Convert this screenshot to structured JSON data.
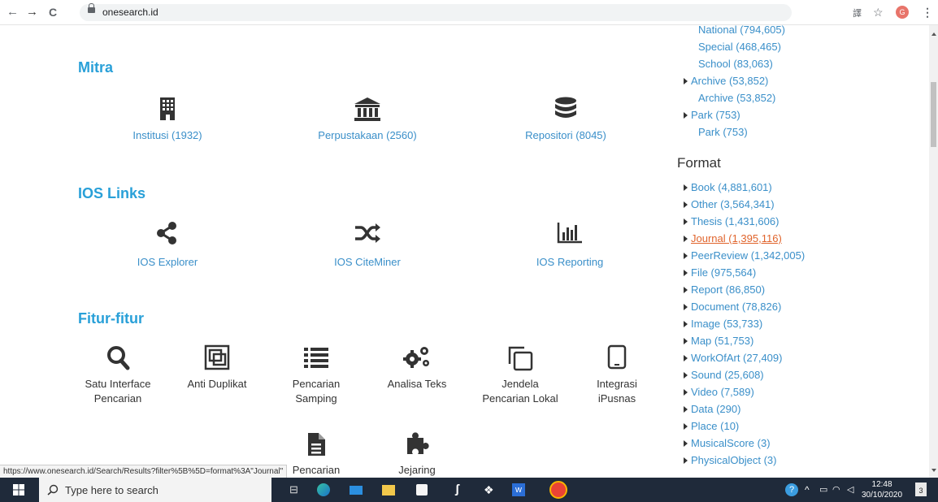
{
  "browser": {
    "url": "onesearch.id",
    "nav_back": "←",
    "nav_forward": "→",
    "nav_reload": "C"
  },
  "main": {
    "mitra": {
      "title": "Mitra",
      "items": [
        {
          "label": "Institusi (1932)",
          "icon": "building-icon"
        },
        {
          "label": "Perpustakaan (2560)",
          "icon": "library-icon"
        },
        {
          "label": "Repositori (8045)",
          "icon": "database-icon"
        }
      ]
    },
    "ios_links": {
      "title": "IOS Links",
      "items": [
        {
          "label": "IOS Explorer",
          "icon": "share-icon"
        },
        {
          "label": "IOS CiteMiner",
          "icon": "shuffle-icon"
        },
        {
          "label": "IOS Reporting",
          "icon": "bar-chart-icon"
        }
      ]
    },
    "fitur": {
      "title": "Fitur-fitur",
      "items": [
        {
          "line1": "Satu Interface",
          "line2": "Pencarian",
          "icon": "search-icon"
        },
        {
          "line1": "Anti Duplikat",
          "line2": "",
          "icon": "duplicate-icon"
        },
        {
          "line1": "Pencarian",
          "line2": "Samping",
          "icon": "list-icon"
        },
        {
          "line1": "Analisa Teks",
          "line2": "",
          "icon": "gears-icon"
        },
        {
          "line1": "Jendela",
          "line2": "Pencarian Lokal",
          "icon": "windows-icon"
        },
        {
          "line1": "Integrasi",
          "line2": "iPusnas",
          "icon": "tablet-icon"
        },
        {
          "line1": "Pencarian",
          "line2": "",
          "icon": "document-icon"
        },
        {
          "line1": "Jejaring",
          "line2": "",
          "icon": "puzzle-icon"
        }
      ]
    }
  },
  "sidebar": {
    "top_items": [
      {
        "label": "National (794,605)",
        "indent": true
      },
      {
        "label": "Special (468,465)",
        "indent": true
      },
      {
        "label": "School (83,063)",
        "indent": true
      },
      {
        "label": "Archive (53,852)",
        "indent": false
      },
      {
        "label": "Archive (53,852)",
        "indent": true
      },
      {
        "label": "Park (753)",
        "indent": false
      },
      {
        "label": "Park (753)",
        "indent": true
      }
    ],
    "format_title": "Format",
    "format_items": [
      "Book (4,881,601)",
      "Other (3,564,341)",
      "Thesis (1,431,606)",
      "Journal (1,395,116)",
      "PeerReview (1,342,005)",
      "File (975,564)",
      "Report (86,850)",
      "Document (78,826)",
      "Image (53,733)",
      "Map (51,753)",
      "WorkOfArt (27,409)",
      "Sound (25,608)",
      "Video (7,589)",
      "Data (290)",
      "Place (10)",
      "MusicalScore (3)",
      "PhysicalObject (3)"
    ],
    "active_color": "#e0642c",
    "link_color": "#3a8fc9"
  },
  "status_url": "https://www.onesearch.id/Search/Results?filter%5B%5D=format%3A\"Journal\"",
  "taskbar": {
    "search_placeholder": "Type here to search",
    "time": "12:48",
    "date": "30/10/2020",
    "notif_count": "3"
  },
  "avatar_letter": "G"
}
